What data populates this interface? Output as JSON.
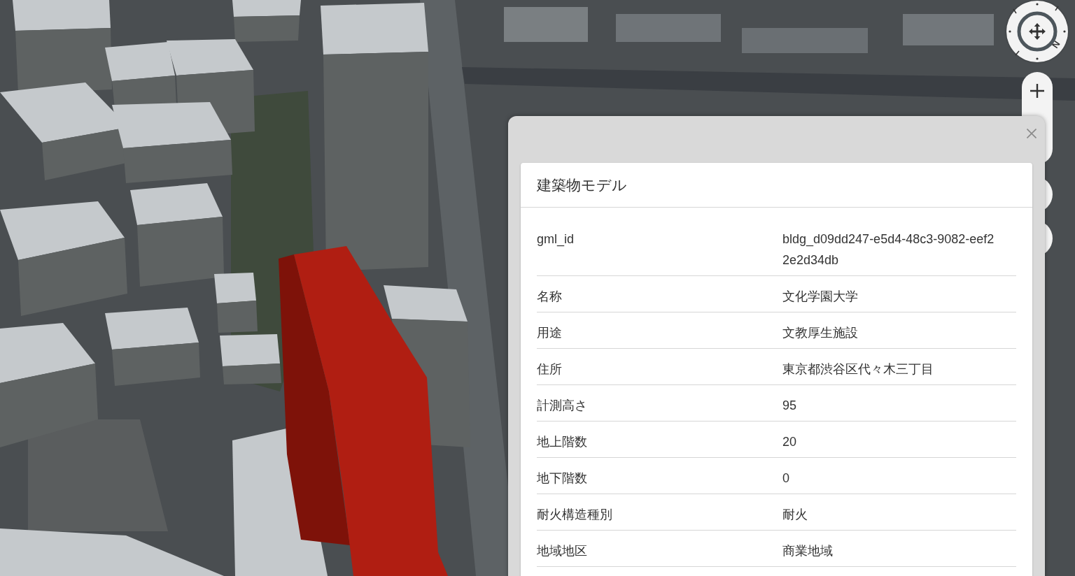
{
  "compass": {
    "north_label": "N"
  },
  "panel": {
    "title": "建築物モデル",
    "attributes": [
      {
        "name": "gml_id",
        "value": "bldg_d09dd247-e5d4-48c3-9082-eef22e2d34db"
      },
      {
        "name": "名称",
        "value": "文化学園大学"
      },
      {
        "name": "用途",
        "value": "文教厚生施設"
      },
      {
        "name": "住所",
        "value": "東京都渋谷区代々木三丁目"
      },
      {
        "name": "計測高さ",
        "value": "95"
      },
      {
        "name": "地上階数",
        "value": "20"
      },
      {
        "name": "地下階数",
        "value": "0"
      },
      {
        "name": "耐火構造種別",
        "value": "耐火"
      },
      {
        "name": "地域地区",
        "value": "商業地域"
      }
    ]
  }
}
